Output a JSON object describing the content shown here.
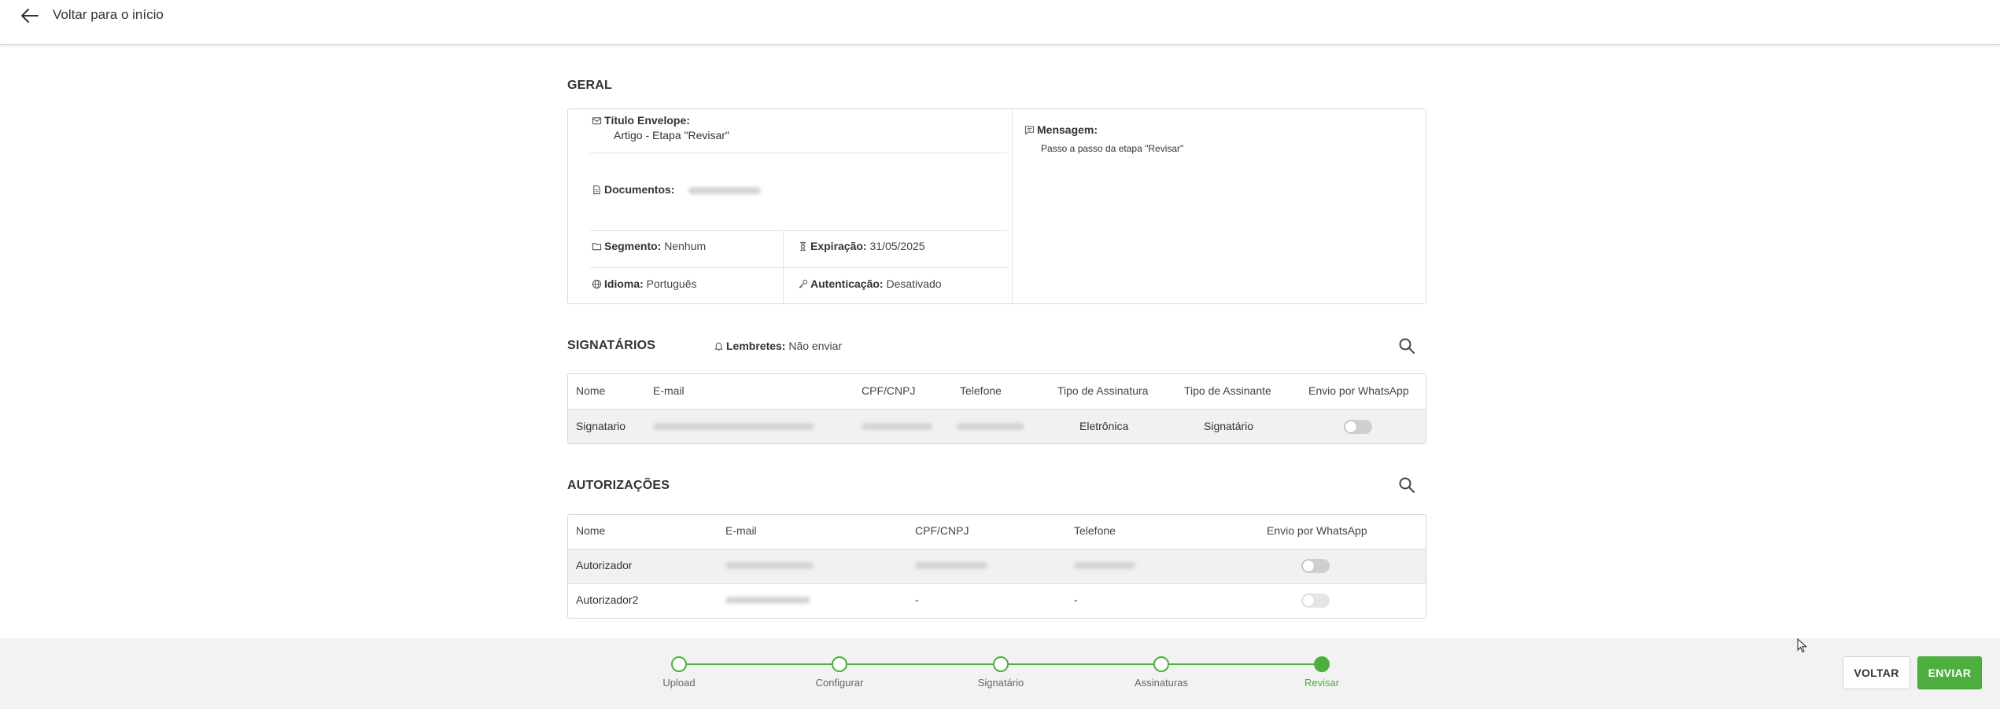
{
  "header": {
    "back_label": "Voltar para o início"
  },
  "geral": {
    "title": "GERAL",
    "titulo_label": "Título Envelope:",
    "titulo_value": "Artigo - Etapa \"Revisar\"",
    "documentos_label": "Documentos:",
    "segmento_label": "Segmento:",
    "segmento_value": "Nenhum",
    "expiracao_label": "Expiração:",
    "expiracao_value": "31/05/2025",
    "idioma_label": "Idioma:",
    "idioma_value": "Português",
    "autenticacao_label": "Autenticação:",
    "autenticacao_value": "Desativado",
    "mensagem_label": "Mensagem:",
    "mensagem_value": "Passo a passo da etapa \"Revisar\""
  },
  "signatarios": {
    "title": "SIGNATÁRIOS",
    "lembretes_label": "Lembretes:",
    "lembretes_value": "Não enviar",
    "columns": [
      "Nome",
      "E-mail",
      "CPF/CNPJ",
      "Telefone",
      "Tipo de Assinatura",
      "Tipo de Assinante",
      "Envio por WhatsApp"
    ],
    "rows": [
      {
        "nome": "Signatario",
        "tipo_assinatura": "Eletrônica",
        "tipo_assinante": "Signatário",
        "whatsapp": false
      }
    ]
  },
  "autorizacoes": {
    "title": "AUTORIZAÇÕES",
    "columns": [
      "Nome",
      "E-mail",
      "CPF/CNPJ",
      "Telefone",
      "Envio por WhatsApp"
    ],
    "rows": [
      {
        "nome": "Autorizador",
        "cpf": "",
        "telefone": "",
        "whatsapp": false
      },
      {
        "nome": "Autorizador2",
        "cpf": "-",
        "telefone": "-",
        "whatsapp": false
      }
    ]
  },
  "steps": [
    {
      "label": "Upload",
      "done": true
    },
    {
      "label": "Configurar",
      "done": true
    },
    {
      "label": "Signatário",
      "done": true
    },
    {
      "label": "Assinaturas",
      "done": true
    },
    {
      "label": "Revisar",
      "done": true,
      "active": true
    }
  ],
  "buttons": {
    "back": "VOLTAR",
    "send": "ENVIAR"
  },
  "colors": {
    "accent": "#4caf3e",
    "border": "#dcdcdc",
    "footer_bg": "#f2f2f2"
  },
  "icons": [
    "arrow-left-icon",
    "envelope-icon",
    "document-icon",
    "folder-icon",
    "hourglass-icon",
    "globe-icon",
    "key-icon",
    "message-icon",
    "bell-icon",
    "search-icon"
  ]
}
